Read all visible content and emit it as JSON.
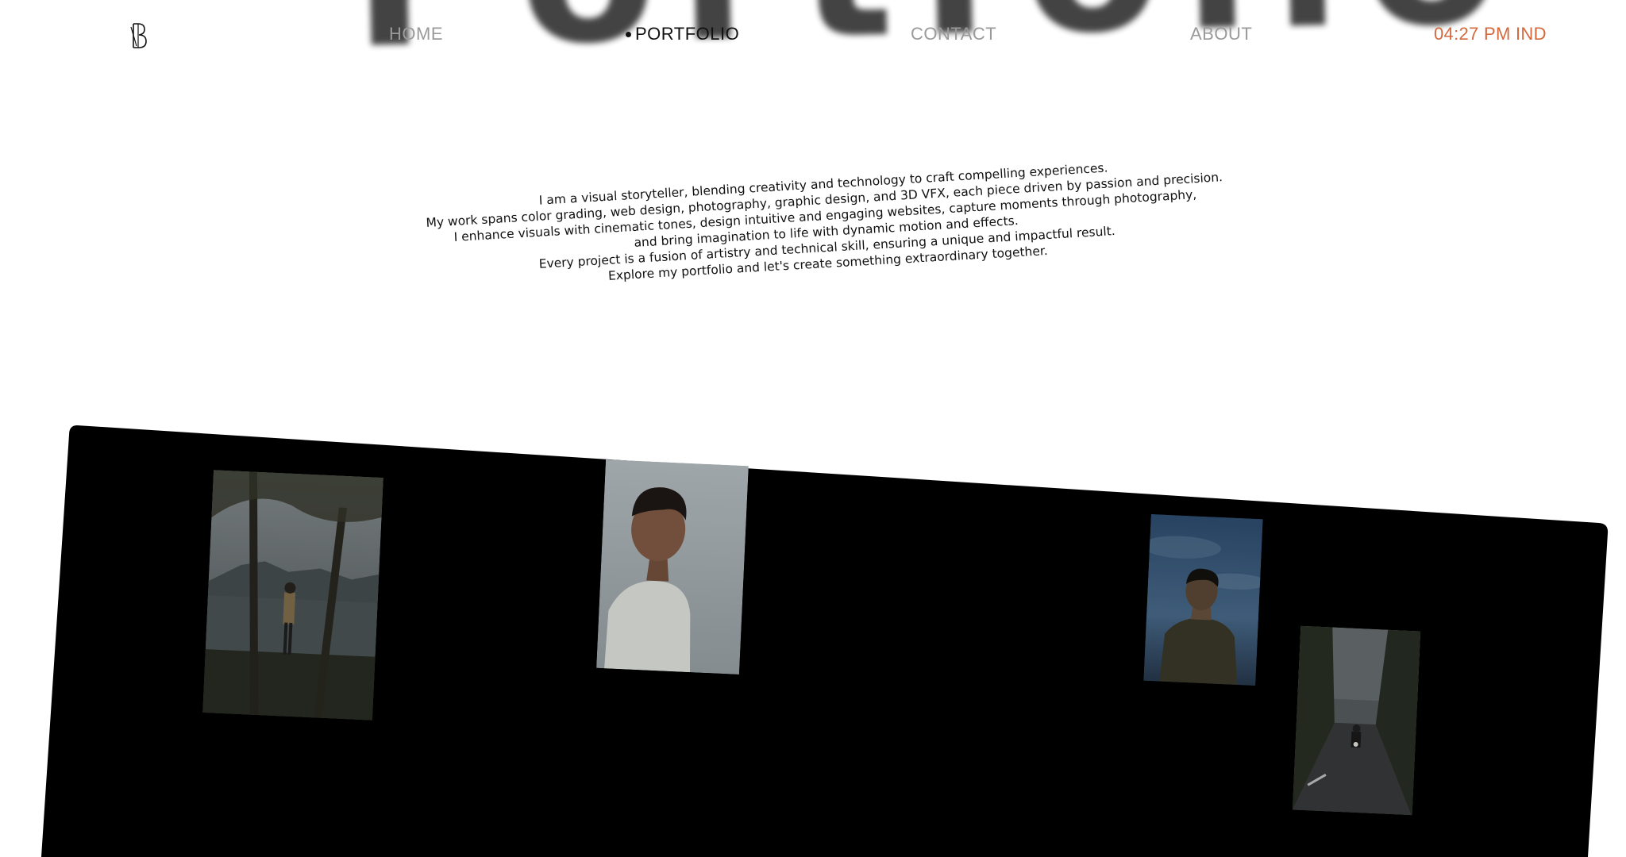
{
  "hero": {
    "title": "Portfolio"
  },
  "nav": {
    "logo_icon": "monogram-logo-icon",
    "items": [
      {
        "label": "HOME",
        "active": false
      },
      {
        "label": "PORTFOLIO",
        "active": true
      },
      {
        "label": "CONTACT",
        "active": false
      },
      {
        "label": "ABOUT",
        "active": false
      }
    ],
    "clock": "04:27 PM IND"
  },
  "intro": {
    "lines": [
      "I am a visual storyteller, blending creativity and technology to craft compelling experiences.",
      "My work spans color grading, web design, photography, graphic design, and 3D VFX, each piece driven by passion and precision.",
      "I enhance visuals with cinematic tones, design intuitive and engaging websites, capture moments through photography,",
      "and bring imagination to life with dynamic motion and effects.",
      "Every project is a fusion of artistry and technical skill, ensuring a unique and impactful result.",
      "Explore my portfolio and let's create something extraordinary together."
    ]
  },
  "gallery": {
    "photos": [
      {
        "subject": "person-standing-by-lake-with-trees"
      },
      {
        "subject": "man-profile-against-grey-sky"
      },
      {
        "subject": "man-at-dusk-blue-sky"
      },
      {
        "subject": "motorcyclist-on-tree-lined-road"
      }
    ]
  },
  "colors": {
    "background": "#ffffff",
    "text": "#111111",
    "nav_inactive": "#9a9a9a",
    "accent_clock": "#d4683d",
    "gallery_panel": "#000000"
  }
}
